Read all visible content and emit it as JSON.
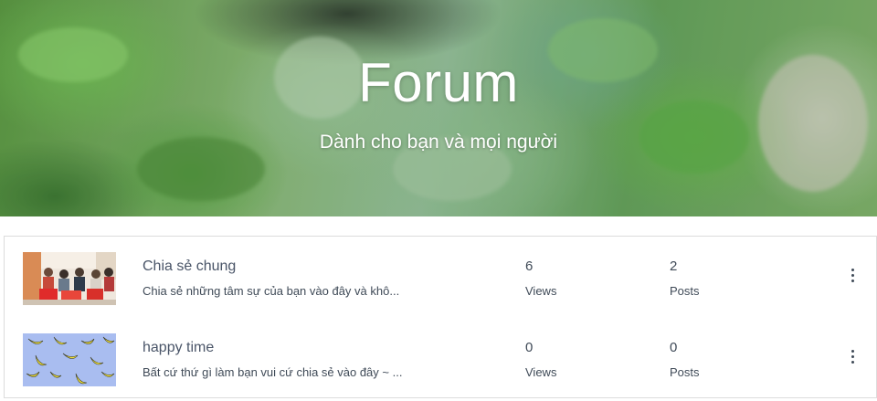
{
  "hero": {
    "title": "Forum",
    "subtitle": "Dành cho bạn và mọi người"
  },
  "categories": [
    {
      "name": "Chia sẻ chung",
      "description": "Chia sẻ những tâm sự của bạn vào đây và khô...",
      "views": "6",
      "views_label": "Views",
      "posts": "2",
      "posts_label": "Posts",
      "thumbnail": "group-meeting-photo"
    },
    {
      "name": "happy time",
      "description": "Bất cứ thứ gì làm bạn vui cứ chia sẻ vào đây ~ ...",
      "views": "0",
      "views_label": "Views",
      "posts": "0",
      "posts_label": "Posts",
      "thumbnail": "banana-pattern"
    }
  ],
  "icons": {
    "more": "more-vertical-icon"
  },
  "colors": {
    "text": "#3f4a57",
    "border": "#dcdcdc",
    "hero_green": "#6aa860",
    "banana_bg": "#a9bdf0",
    "banana_yellow": "#f2e23a"
  }
}
